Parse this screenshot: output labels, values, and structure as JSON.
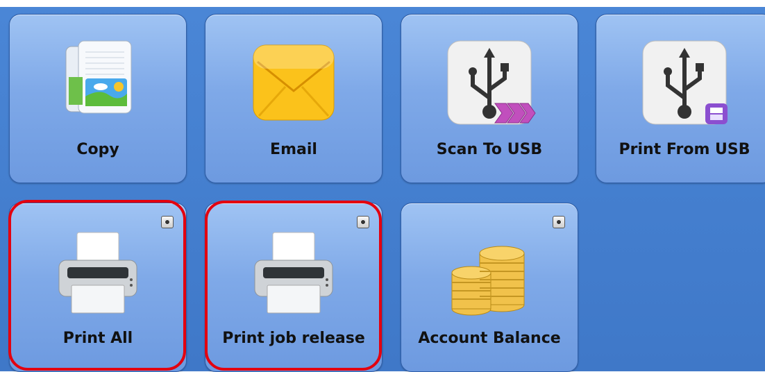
{
  "tiles": [
    {
      "name": "copy-tile",
      "label": "Copy",
      "icon": "copy-icon"
    },
    {
      "name": "email-tile",
      "label": "Email",
      "icon": "email-icon"
    },
    {
      "name": "scan-to-usb-tile",
      "label": "Scan To USB",
      "icon": "scan-to-usb-icon"
    },
    {
      "name": "print-from-usb-tile",
      "label": "Print From USB",
      "icon": "print-from-usb-icon"
    },
    {
      "name": "print-all-tile",
      "label": "Print All",
      "icon": "printer-icon"
    },
    {
      "name": "print-job-release-tile",
      "label": "Print job release",
      "icon": "printer-icon"
    },
    {
      "name": "account-balance-tile",
      "label": "Account Balance",
      "icon": "coins-icon"
    }
  ],
  "colors": {
    "panel": "#4a86d6",
    "tile": "#8bb4ec",
    "highlight": "#e3000f"
  }
}
